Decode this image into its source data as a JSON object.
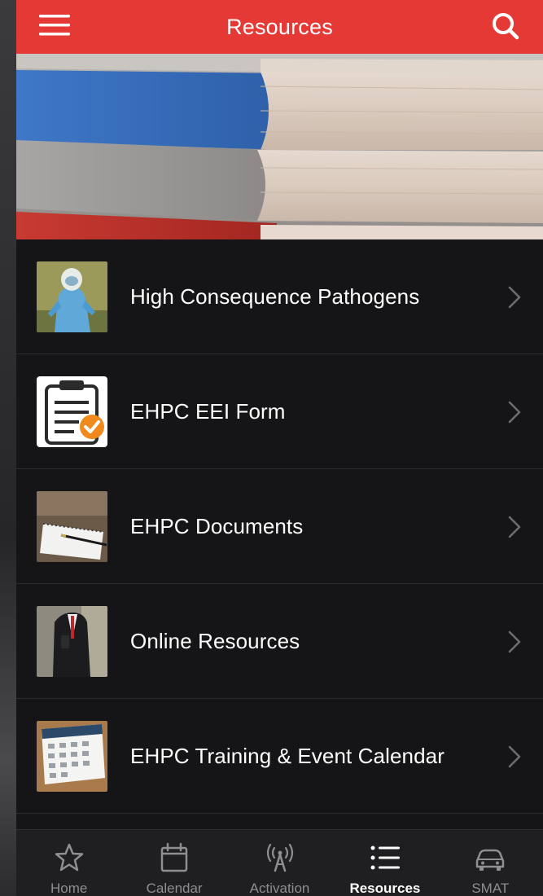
{
  "header": {
    "title": "Resources",
    "menu_icon": "hamburger-menu-icon",
    "search_icon": "search-icon",
    "background_color": "#e53935"
  },
  "banner": {
    "image": "stacked-books-photo"
  },
  "list": {
    "items": [
      {
        "label": "High Consequence Pathogens",
        "thumb": "hazmat-suit-photo"
      },
      {
        "label": "EHPC EEI Form",
        "thumb": "clipboard-check-icon"
      },
      {
        "label": "EHPC Documents",
        "thumb": "notebook-pen-photo"
      },
      {
        "label": "Online Resources",
        "thumb": "businessman-phone-photo"
      },
      {
        "label": "EHPC Training & Event Calendar",
        "thumb": "desk-calendar-photo"
      }
    ]
  },
  "tabbar": {
    "tabs": [
      {
        "label": "Home",
        "icon": "star-icon",
        "active": false
      },
      {
        "label": "Calendar",
        "icon": "calendar-icon",
        "active": false
      },
      {
        "label": "Activation",
        "icon": "broadcast-icon",
        "active": false
      },
      {
        "label": "Resources",
        "icon": "list-icon",
        "active": true
      },
      {
        "label": "SMAT",
        "icon": "car-icon",
        "active": false
      }
    ]
  }
}
